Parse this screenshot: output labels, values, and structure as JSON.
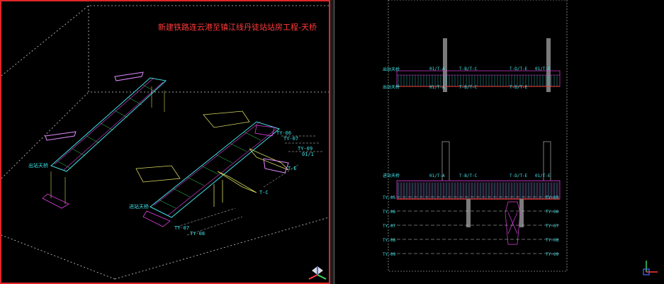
{
  "left_view": {
    "title": "新建铁路连云港至镇江线丹徒站站房工程-天桥",
    "labels": {
      "exit_bridge": "出站天桥",
      "entry_bridge": "进站天桥",
      "ty06": "TY-06",
      "ty07": "TY-07",
      "ty08": "TY-08",
      "ty09": "TY-09",
      "axis01": "01/1",
      "axis_e": "T-E",
      "axis_c": "T-C"
    }
  },
  "right_view": {
    "top_elevation": {
      "label_left": "出站天桥",
      "axis_a": "01/T-A",
      "axis_c": "T-B/T-C",
      "axis_e": "T-D/T-E",
      "axis_end": "01/T-E"
    },
    "bottom_elevation": {
      "label_left": "进站天桥",
      "axis_a": "01/T-A",
      "axis_c": "T-B/T-C",
      "axis_e": "T-D/T-E",
      "axis_end": "01/T-E",
      "rows": [
        "TY-05",
        "TY-06",
        "TY-07",
        "TY-08",
        "TY-09"
      ]
    }
  },
  "colors": {
    "viewport_active_border": "#e0262b",
    "cyan": "#41e2e6",
    "red": "#ff3a3a",
    "green": "#39d65a",
    "magenta": "#e040e0",
    "yellow": "#d8d860",
    "white": "#d8d8d8"
  }
}
